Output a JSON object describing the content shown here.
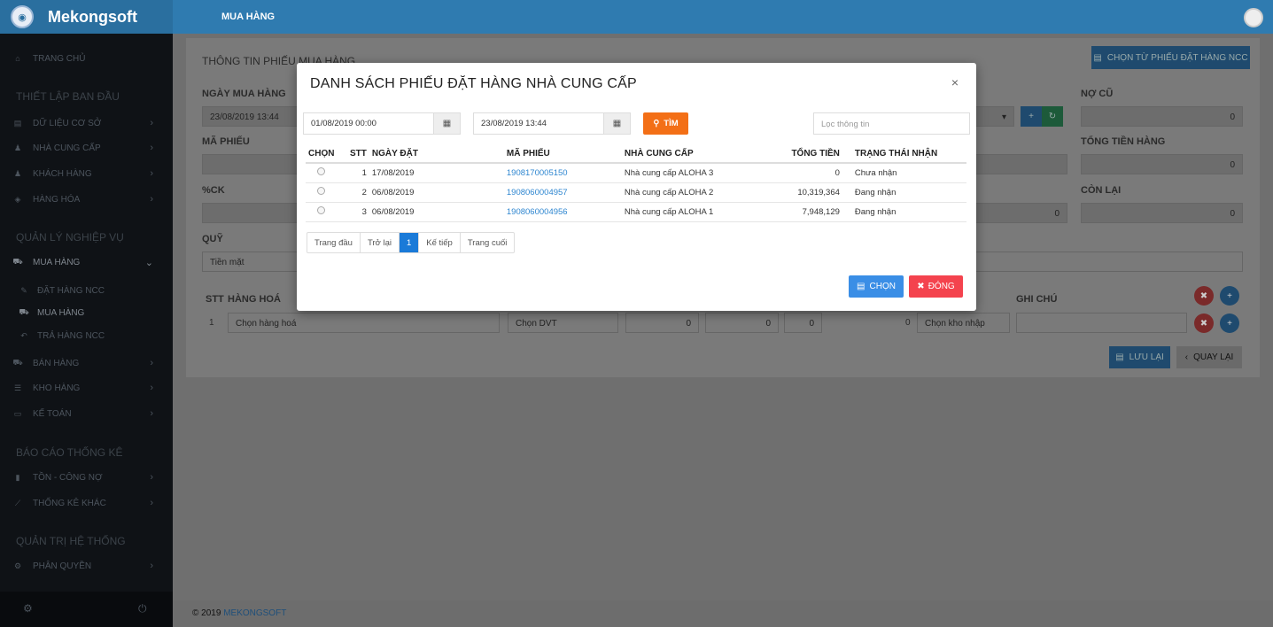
{
  "header": {
    "brand": "Mekongsoft",
    "page_title": "MUA HÀNG"
  },
  "sidebar": {
    "items": [
      {
        "label": "TRANG CHỦ",
        "icon": "home-icon"
      },
      {
        "label": "DỮ LIỆU CƠ SỞ",
        "icon": "database-icon"
      },
      {
        "label": "NHÀ CUNG CẤP",
        "icon": "users-icon"
      },
      {
        "label": "KHÁCH HÀNG",
        "icon": "group-icon"
      },
      {
        "label": "HÀNG HÓA",
        "icon": "box-icon"
      },
      {
        "label": "MUA HÀNG",
        "icon": "cart-icon"
      },
      {
        "label": "ĐẶT HÀNG NCC",
        "icon": "edit-icon"
      },
      {
        "label": "MUA HÀNG",
        "icon": "cart-icon"
      },
      {
        "label": "TRẢ HÀNG NCC",
        "icon": "undo-icon"
      },
      {
        "label": "BÁN HÀNG",
        "icon": "cart-icon"
      },
      {
        "label": "KHO HÀNG",
        "icon": "list-icon"
      },
      {
        "label": "KẾ TOÁN",
        "icon": "card-icon"
      },
      {
        "label": "TỒN - CÔNG NỢ",
        "icon": "bar-chart-icon"
      },
      {
        "label": "THỐNG KÊ KHÁC",
        "icon": "line-chart-icon"
      },
      {
        "label": "PHÂN QUYỀN",
        "icon": "gears-icon"
      }
    ],
    "headers": [
      "THIẾT LẬP BAN ĐẦU",
      "QUẢN LÝ NGHIỆP VỤ",
      "BÁO CÁO THỐNG KÊ",
      "QUẢN TRỊ HỆ THỐNG"
    ]
  },
  "form": {
    "section_title": "THÔNG TIN PHIẾU MUA HÀNG",
    "choose_order_button": "CHỌN TỪ PHIẾU ĐẶT HÀNG NCC",
    "ngay_mua_hang_label": "NGÀY MUA HÀNG",
    "ngay_mua_hang": "23/08/2019 13:44",
    "ma_phieu_label": "MÃ PHIẾU",
    "ck_label": "%CK",
    "quy_label": "QUỸ",
    "quy_value": "Tiền mặt",
    "no_cu_label": "NỢ CŨ",
    "no_cu": "0",
    "tong_tien_hang_label": "TỔNG TIỀN HÀNG",
    "tong_tien_hang": "0",
    "con_lai_label": "CÒN LẠI",
    "con_lai": "0",
    "mid_value": "0"
  },
  "items_table": {
    "headers": {
      "stt": "STT",
      "hang_hoa": "HÀNG HOÁ",
      "ghi_chu": "GHI CHÚ"
    },
    "row": {
      "stt": "1",
      "hang_hoa": "Chọn hàng hoá",
      "dvt": "Chọn DVT",
      "v1": "0",
      "v2": "0",
      "v3": "0",
      "v4": "0",
      "kho": "Chọn kho nhập"
    }
  },
  "actions": {
    "save": "LƯU LẠI",
    "back": "QUAY LẠI"
  },
  "footer": {
    "copyright": "© 2019",
    "company": "MEKONGSOFT"
  },
  "modal": {
    "title": "DANH SÁCH PHIẾU ĐẶT HÀNG NHÀ CUNG CẤP",
    "close": "×",
    "from_date": "01/08/2019 00:00",
    "to_date": "23/08/2019 13:44",
    "search_button": "TÌM",
    "filter_placeholder": "Lọc thông tin",
    "columns": [
      "CHỌN",
      "STT",
      "NGÀY ĐẶT",
      "MÃ PHIẾU",
      "NHÀ CUNG CẤP",
      "TỔNG TIỀN",
      "TRẠNG THÁI NHẬN"
    ],
    "rows": [
      {
        "stt": "1",
        "ngay_dat": "17/08/2019",
        "ma_phieu": "1908170005150",
        "nha_cung_cap": "Nhà cung cấp ALOHA 3",
        "tong_tien": "0",
        "trang_thai": "Chưa nhận"
      },
      {
        "stt": "2",
        "ngay_dat": "06/08/2019",
        "ma_phieu": "1908060004957",
        "nha_cung_cap": "Nhà cung cấp ALOHA 2",
        "tong_tien": "10,319,364",
        "trang_thai": "Đang nhận"
      },
      {
        "stt": "3",
        "ngay_dat": "06/08/2019",
        "ma_phieu": "1908060004956",
        "nha_cung_cap": "Nhà cung cấp ALOHA 1",
        "tong_tien": "7,948,129",
        "trang_thai": "Đang nhận"
      }
    ],
    "pager": {
      "first": "Trang đầu",
      "prev": "Trở lại",
      "current": "1",
      "next": "Kế tiếp",
      "last": "Trang cuối"
    },
    "choose_button": "CHỌN",
    "close_button": "ĐÓNG",
    "colors": {
      "search": "#f36f16",
      "choose": "#3a8ee6",
      "close": "#f4434e",
      "link": "#2e86d0"
    }
  }
}
